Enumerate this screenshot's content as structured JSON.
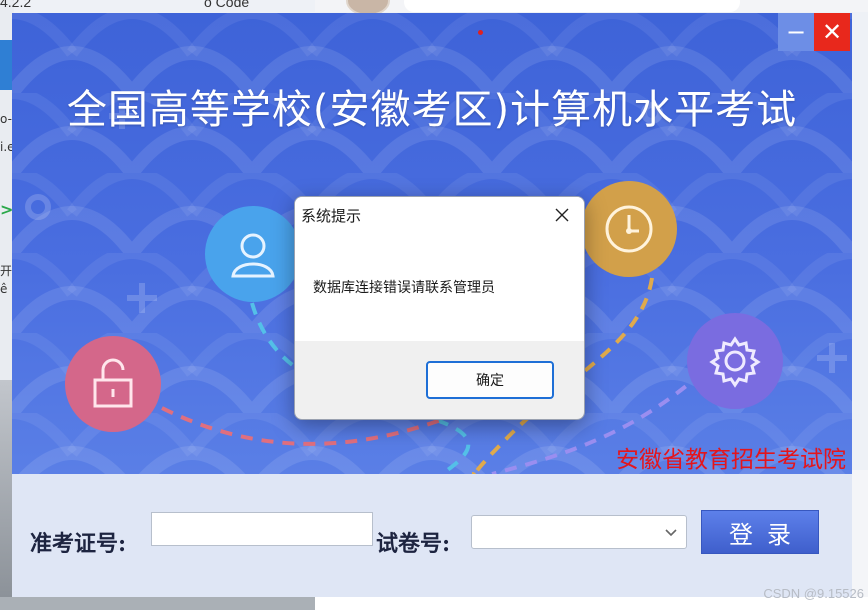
{
  "background": {
    "left_window_fragments": [
      "4.2.2",
      "o Code"
    ],
    "left_edge_fragments": [
      "o-",
      "i.e",
      ">",
      "开",
      "ê"
    ],
    "watermark": "CSDN @9.15526"
  },
  "window": {
    "title": "全国高等学校(安徽考区)计算机水平考试",
    "organization": "安徽省教育招生考试院",
    "minimize_label": "−",
    "close_label": "✕",
    "accent_color": "#4a6ee0"
  },
  "login": {
    "id_label": "准考证号:",
    "id_value": "",
    "paper_label": "试卷号:",
    "paper_value": "",
    "login_button": "登录"
  },
  "dialog": {
    "title": "系统提示",
    "message": "数据库连接错误请联系管理员",
    "ok_button": "确定"
  },
  "icons": [
    "user-icon",
    "unlock-icon",
    "clock-icon",
    "gear-icon",
    "close-icon",
    "minimize-icon",
    "chevron-down-icon"
  ]
}
